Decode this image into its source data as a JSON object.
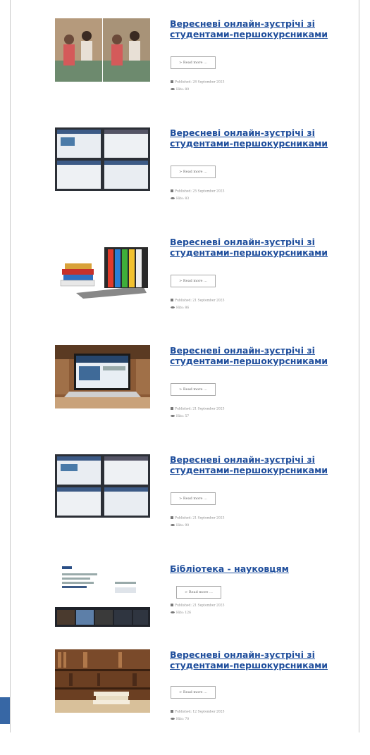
{
  "articles": [
    {
      "title": "Вересневі онлайн-зустрічі зі студентами-першокурсниками",
      "read_more": "> Read more ...",
      "published": "Published: 28 September 2023",
      "hits": "Hits: 80",
      "thumb": "photo-people-icon"
    },
    {
      "title": "Вересневі онлайн-зустрічі зі студентами-першокурсниками",
      "read_more": "> Read more ...",
      "published": "Published: 25 September 2023",
      "hits": "Hits: 83",
      "thumb": "video-conference-icon"
    },
    {
      "title": "Вересневі онлайн-зустрічі зі студентами-першокурсниками",
      "read_more": "> Read more ...",
      "published": "Published: 21 September 2023",
      "hits": "Hits: 86",
      "thumb": "books-laptop-icon"
    },
    {
      "title": "Вересневі онлайн-зустрічі зі студентами-першокурсниками",
      "read_more": "> Read more ...",
      "published": "Published: 21 September 2023",
      "hits": "Hits: 57",
      "thumb": "laptop-library-icon"
    },
    {
      "title": "Вересневі онлайн-зустрічі зі студентами-першокурсниками",
      "read_more": "> Read more ...",
      "published": "Published: 21 September 2023",
      "hits": "Hits: 90",
      "thumb": "video-conference-icon"
    },
    {
      "title": "Бібліотека - науковцям",
      "read_more": "> Read more ...",
      "published": "Published: 21 September 2023",
      "hits": "Hits: 126",
      "thumb": "screen-share-icon"
    },
    {
      "title": "Вересневі онлайн-зустрічі зі студентами-першокурсниками",
      "read_more": "> Read more ...",
      "published": "Published: 12 September 2023",
      "hits": "Hits: 70",
      "thumb": "bookshelf-icon"
    }
  ],
  "colors": {
    "link": "#1f4e9c",
    "accent": "#3767a5"
  }
}
